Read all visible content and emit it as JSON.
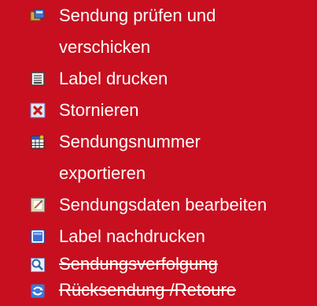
{
  "menu": {
    "items": [
      {
        "label_lines": [
          "Sendung prüfen und",
          "verschicken"
        ],
        "icon": "package-send-icon",
        "strikethrough": false
      },
      {
        "label_lines": [
          "Label drucken"
        ],
        "icon": "printer-icon",
        "strikethrough": false
      },
      {
        "label_lines": [
          "Stornieren"
        ],
        "icon": "cancel-x-icon",
        "strikethrough": false
      },
      {
        "label_lines": [
          "Sendungsnummer",
          "exportieren"
        ],
        "icon": "export-table-icon",
        "strikethrough": false
      },
      {
        "label_lines": [
          "Sendungsdaten bearbeiten"
        ],
        "icon": "edit-note-icon",
        "strikethrough": false
      },
      {
        "label_lines": [
          "Label nachdrucken"
        ],
        "icon": "reprint-window-icon",
        "strikethrough": false
      },
      {
        "label_lines": [
          "Sendungsverfolgung"
        ],
        "icon": "search-magnifier-icon",
        "strikethrough": true
      },
      {
        "label_lines": [
          "Rücksendung /Retoure"
        ],
        "icon": "return-arrows-icon",
        "strikethrough": true
      }
    ]
  },
  "colors": {
    "background": "#c80f1f",
    "text": "#ffffff"
  }
}
